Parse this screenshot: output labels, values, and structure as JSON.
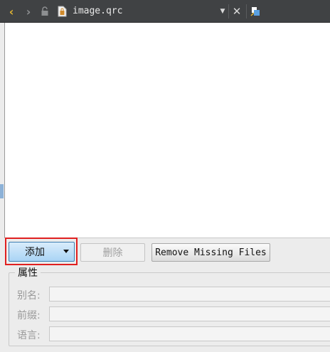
{
  "toolbar": {
    "file_name": "image.qrc",
    "back_icon": "chevron-left-icon",
    "forward_icon": "chevron-right-icon",
    "lock_icon": "lock-icon",
    "file_icon": "qrc-file-icon",
    "dropdown_icon": "chevron-down-icon",
    "close_icon": "close-icon",
    "split_icon": "split-view-icon"
  },
  "buttons": {
    "add_label": "添加",
    "delete_label": "删除",
    "remove_missing_label": "Remove Missing Files"
  },
  "properties": {
    "title": "属性",
    "alias_label": "别名:",
    "alias_value": "",
    "prefix_label": "前缀:",
    "prefix_value": "",
    "language_label": "语言:",
    "language_value": ""
  },
  "colors": {
    "toolbar_bg": "#404244",
    "accent_arrow": "#e1b431",
    "highlight": "#e02020",
    "add_button": "#a9d4f5"
  }
}
